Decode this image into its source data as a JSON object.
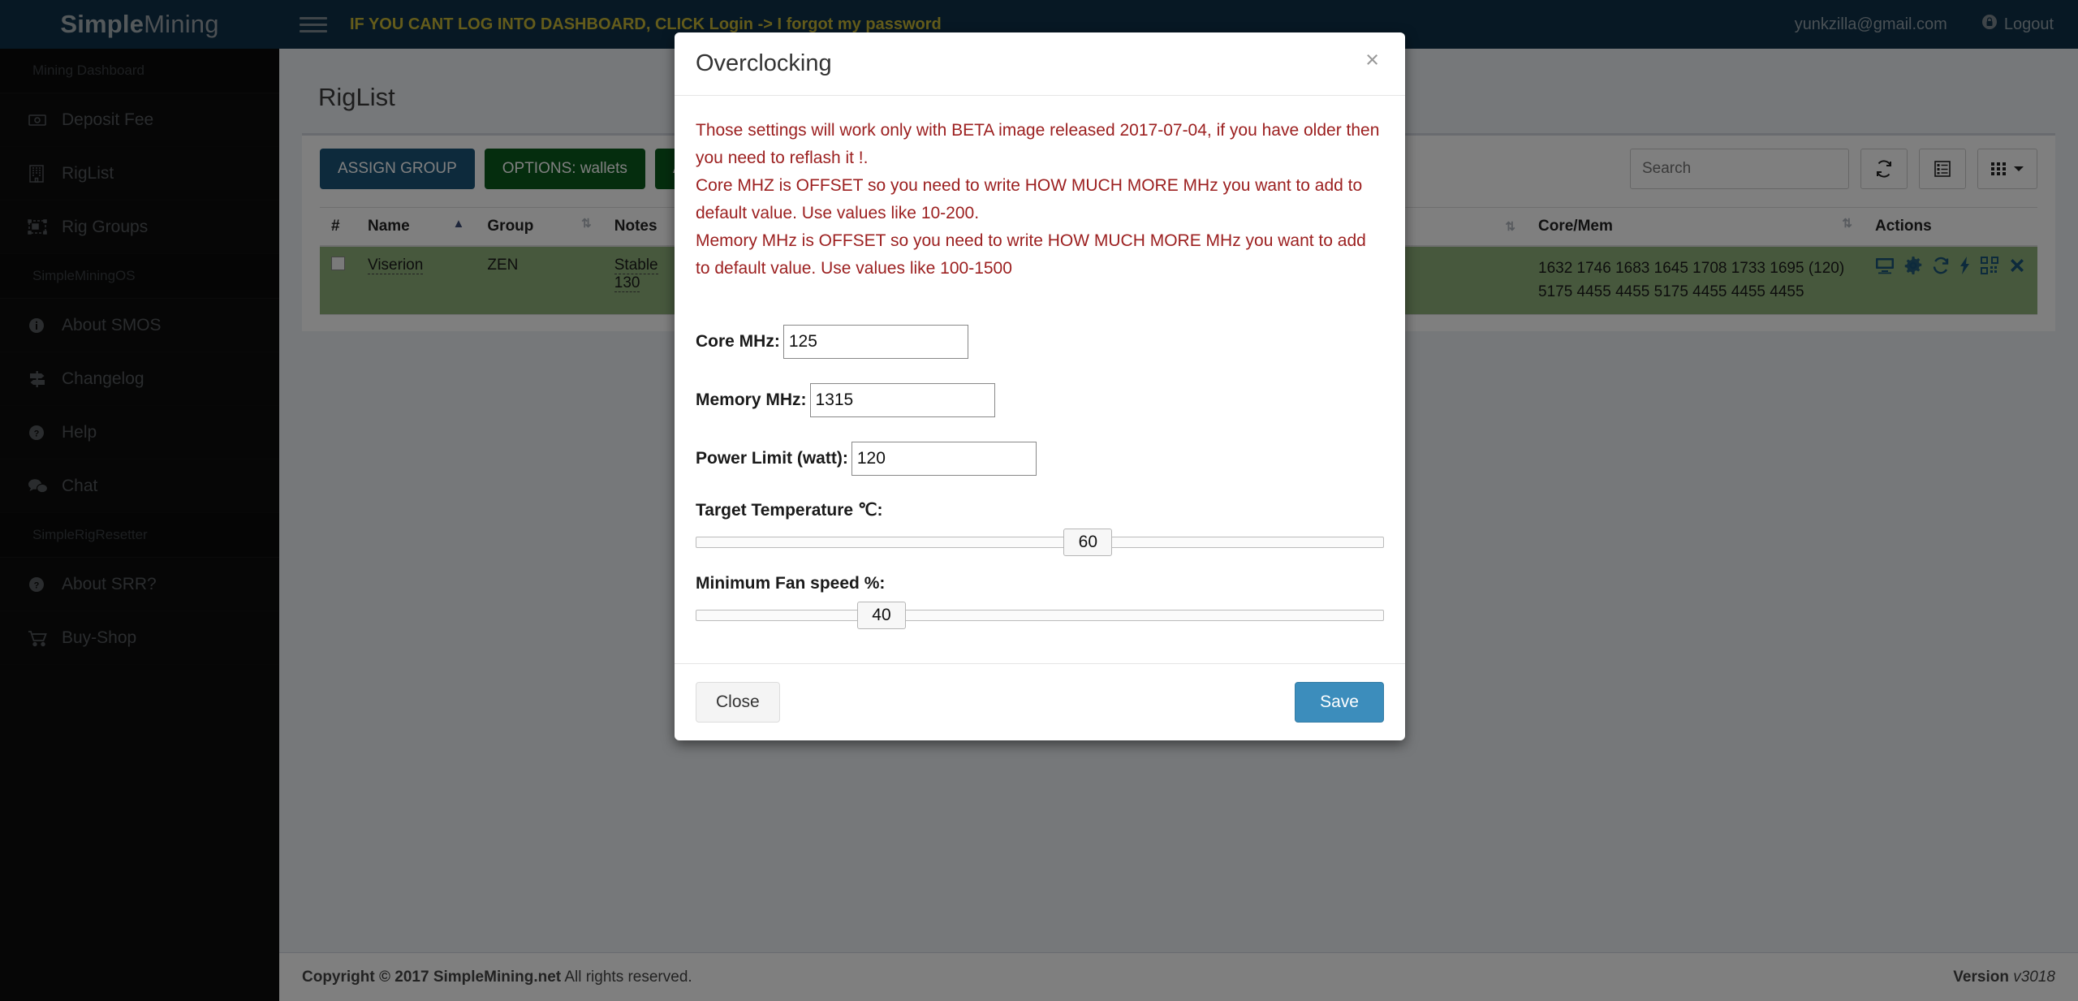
{
  "brand": {
    "bold": "Simple",
    "light": "Mining"
  },
  "topbar": {
    "alert": "IF YOU CANT LOG INTO DASHBOARD, CLICK Login -> I forgot my password",
    "user_email": "yunkzilla@gmail.com",
    "logout_label": "Logout"
  },
  "sidebar": {
    "sections": [
      {
        "heading": "Mining Dashboard",
        "items": [
          {
            "label": "Deposit Fee",
            "icon": "money-bill-icon"
          },
          {
            "label": "RigList",
            "icon": "building-icon"
          },
          {
            "label": "Rig Groups",
            "icon": "object-group-icon"
          }
        ]
      },
      {
        "heading": "SimpleMiningOS",
        "items": [
          {
            "label": "About SMOS",
            "icon": "info-circle-icon"
          },
          {
            "label": "Changelog",
            "icon": "signs-icon"
          },
          {
            "label": "Help",
            "icon": "question-circle-icon"
          },
          {
            "label": "Chat",
            "icon": "comments-icon"
          }
        ]
      },
      {
        "heading": "SimpleRigResetter",
        "items": [
          {
            "label": "About SRR?",
            "icon": "question-circle-icon"
          },
          {
            "label": "Buy-Shop",
            "icon": "shopping-cart-icon"
          }
        ]
      }
    ]
  },
  "page": {
    "title": "RigList",
    "buttons": [
      {
        "label": "ASSIGN GROUP",
        "style": "primary"
      },
      {
        "label": "OPTIONS: wallets",
        "style": "green"
      },
      {
        "label": "All rigs",
        "style": "green"
      }
    ],
    "search_placeholder": "Search",
    "toolbar_icons": [
      {
        "name": "refresh-icon"
      },
      {
        "name": "list-view-icon"
      },
      {
        "name": "grid-view-icon"
      }
    ]
  },
  "table": {
    "columns": [
      {
        "label": "#",
        "sortable": false
      },
      {
        "label": "Name",
        "sortable": true,
        "sorted": "asc"
      },
      {
        "label": "Group",
        "sortable": true
      },
      {
        "label": "Notes",
        "sortable": false
      },
      {
        "label": "",
        "sortable": true
      },
      {
        "label": "Core/Mem",
        "sortable": true
      },
      {
        "label": "Actions",
        "sortable": false
      }
    ],
    "rows": [
      {
        "checkbox": false,
        "name": "Viserion",
        "group": "ZEN",
        "notes_line1": "Stable",
        "notes_line2": "130",
        "core": "1632 1746 1683 1645 1708 1733 1695 (120)",
        "mem": "5175 4455 4455 5175 4455 4455 4455",
        "actions": [
          {
            "name": "monitor-icon"
          },
          {
            "name": "gear-icon"
          },
          {
            "name": "reload-icon"
          },
          {
            "name": "bolt-icon"
          },
          {
            "name": "qrcode-icon"
          },
          {
            "name": "delete-x-icon"
          }
        ]
      }
    ]
  },
  "footer": {
    "copyright_bold": "Copyright © 2017 SimpleMining.net",
    "copyright_rest": " All rights reserved.",
    "version_label": "Version ",
    "version_value": "v3018"
  },
  "modal": {
    "title": "Overclocking",
    "close_glyph": "×",
    "warning": [
      "Those settings will work only with BETA image released 2017-07-04, if you have older then you need to reflash it !.",
      "Core MHZ is OFFSET so you need to write HOW MUCH MORE MHz you want to add to default value. Use values like 10-200.",
      "Memory MHz is OFFSET so you need to write HOW MUCH MORE MHz you want to add to default value. Use values like 100-1500"
    ],
    "fields": {
      "core_label": "Core MHz:",
      "core_value": "125",
      "memory_label": "Memory MHz:",
      "memory_value": "1315",
      "power_label": "Power Limit (watt):",
      "power_value": "120"
    },
    "sliders": [
      {
        "label": "Target Temperature ℃:",
        "value": "60",
        "percent": 57
      },
      {
        "label": "Minimum Fan speed %:",
        "value": "40",
        "percent": 27
      }
    ],
    "buttons": {
      "close": "Close",
      "save": "Save"
    },
    "colors": {
      "warning_text": "#9c2020",
      "save_bg": "#3c8dbc"
    }
  }
}
